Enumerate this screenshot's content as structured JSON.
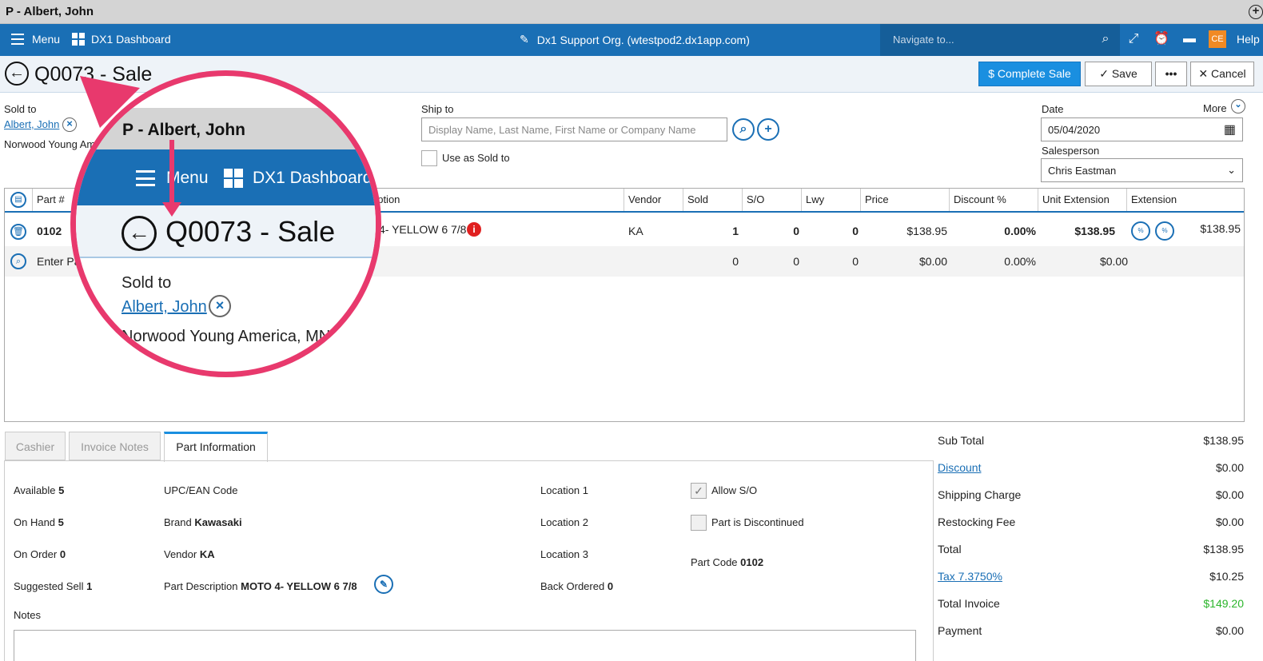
{
  "window": {
    "title": "P - Albert, John"
  },
  "navbar": {
    "menu_label": "Menu",
    "dashboard_label": "DX1 Dashboard",
    "org_label": "Dx1 Support Org. (wtestpod2.dx1app.com)",
    "navigate_placeholder": "Navigate to...",
    "user_initials": "CE",
    "help_label": "Help"
  },
  "header": {
    "title": "Q0073 - Sale",
    "complete_sale_label": "Complete Sale",
    "save_label": "Save",
    "more_label": "•••",
    "cancel_label": "Cancel"
  },
  "customer": {
    "sold_to_label": "Sold to",
    "sold_to_name": "Albert, John",
    "sold_to_address": "Norwood Young Am",
    "ship_to_label": "Ship to",
    "ship_to_placeholder": "Display Name, Last Name, First Name or Company Name",
    "use_as_sold_to_label": "Use as Sold to",
    "date_label": "Date",
    "date_value": "05/04/2020",
    "more_label": "More",
    "salesperson_label": "Salesperson",
    "salesperson_value": "Chris Eastman"
  },
  "grid": {
    "columns": [
      "Part #",
      "ription",
      "Vendor",
      "Sold",
      "S/O",
      "Lwy",
      "Price",
      "Discount %",
      "Unit Extension",
      "Extension"
    ],
    "row": {
      "part": "0102",
      "description": "D 4- YELLOW 6 7/8",
      "vendor": "KA",
      "sold": "1",
      "so": "0",
      "lwy": "0",
      "price": "$138.95",
      "discount": "0.00%",
      "unit_ext": "$138.95",
      "extension": "$138.95"
    },
    "entry_row": {
      "placeholder": "Enter Pa",
      "sold": "0",
      "so": "0",
      "lwy": "0",
      "price": "$0.00",
      "discount": "0.00%",
      "unit_ext": "$0.00"
    }
  },
  "tabs": [
    "Cashier",
    "Invoice Notes",
    "Part Information"
  ],
  "part_info": {
    "available_label": "Available",
    "available_value": "5",
    "onhand_label": "On Hand",
    "onhand_value": "5",
    "onorder_label": "On Order",
    "onorder_value": "0",
    "suggested_label": "Suggested Sell",
    "suggested_value": "1",
    "upc_label": "UPC/EAN Code",
    "brand_label": "Brand",
    "brand_value": "Kawasaki",
    "vendor_label": "Vendor",
    "vendor_value": "KA",
    "desc_label": "Part Description",
    "desc_value": "MOTO 4- YELLOW 6 7/8",
    "loc1_label": "Location 1",
    "loc2_label": "Location 2",
    "loc3_label": "Location 3",
    "backordered_label": "Back Ordered",
    "backordered_value": "0",
    "allow_so_label": "Allow S/O",
    "discontinued_label": "Part is Discontinued",
    "partcode_label": "Part Code",
    "partcode_value": "0102",
    "notes_label": "Notes"
  },
  "totals": {
    "subtotal_label": "Sub Total",
    "subtotal_value": "$138.95",
    "discount_label": "Discount",
    "discount_value": "$0.00",
    "shipping_label": "Shipping Charge",
    "shipping_value": "$0.00",
    "restocking_label": "Restocking Fee",
    "restocking_value": "$0.00",
    "total_label": "Total",
    "total_value": "$138.95",
    "tax_label": "Tax 7.3750%",
    "tax_value": "$10.25",
    "invoice_label": "Total Invoice",
    "invoice_value": "$149.20",
    "payment_label": "Payment",
    "payment_value": "$0.00"
  },
  "magnifier": {
    "title": "P - Albert, John",
    "menu_label": "Menu",
    "dashboard_label": "DX1 Dashboard",
    "page_title": "Q0073 - Sale",
    "sold_to_label": "Sold to",
    "sold_to_name": "Albert, John",
    "address": "Norwood Young America, MN"
  },
  "colors": {
    "brand_blue": "#1a6fb5",
    "accent_pink": "#e8396d",
    "total_green": "#2bb52b",
    "user_orange": "#f08a24"
  }
}
